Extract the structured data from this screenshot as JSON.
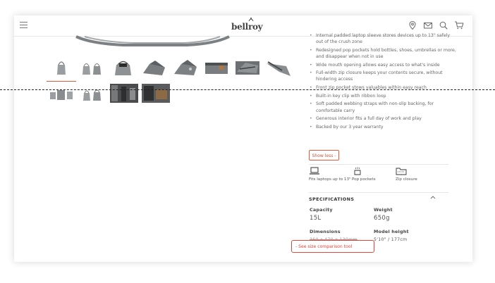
{
  "header": {
    "brand": "bellroy",
    "icons": [
      "menu-icon",
      "location-pin-icon",
      "mail-icon",
      "search-icon",
      "cart-icon"
    ]
  },
  "gallery": {
    "thumbnail_count": 12,
    "active_index": 0
  },
  "features_list": [
    "Internal padded laptop sleeve stores devices up to 13\" safely out of the crush zone",
    "Redesigned pop pockets hold bottles, shoes, umbrellas or more, and disappear when not in use",
    "Wide mouth opening allows easy access to what's inside",
    "Full-width zip closure keeps your contents secure, without hindering access",
    "Front zip pocket stows valuables within easy reach",
    "Built-in key clip with ribbon loop",
    "Soft padded webbing straps with non-slip backing, for comfortable carry",
    "Generous interior fits a full day of work and play",
    "Backed by our 3 year warranty"
  ],
  "show_less_label": "Show less -",
  "feature_icons": [
    {
      "icon": "laptop-icon",
      "label": "Fits laptops up to 13\""
    },
    {
      "icon": "pop-pocket-icon",
      "label": "Pop pockets"
    },
    {
      "icon": "zip-closure-icon",
      "label": "Zip closure"
    }
  ],
  "specifications": {
    "title": "SPECIFICATIONS",
    "capacity_label": "Capacity",
    "capacity_value": "15L",
    "weight_label": "Weight",
    "weight_value": "650g",
    "dimensions_label": "Dimensions",
    "dimensions_value": "360 x 470 x 130mm",
    "model_height_label": "Model height",
    "model_height_value": "5'10\" / 177cm",
    "compare_link": "- See size comparison tool"
  },
  "colors": {
    "accent": "#e05a3c",
    "highlight_box": "#e0473a",
    "product_grey": "#8f9294"
  }
}
